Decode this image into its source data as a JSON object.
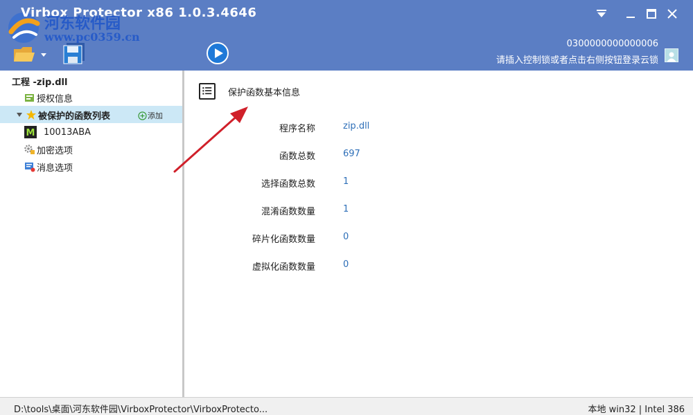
{
  "window": {
    "title": "Virbox Protector x86  1.0.3.4646",
    "controls": [
      "dropdown-icon",
      "minimize-icon",
      "maximize-icon",
      "close-icon"
    ]
  },
  "watermark": {
    "line1": "河东软件园",
    "line2": "www.pc0359.cn"
  },
  "toolbar": {
    "open_icon": "folder-open-icon",
    "save_icon": "save-icon",
    "run_icon": "play-icon"
  },
  "account": {
    "serial": "0300000000000006",
    "hint": "请插入控制锁或者点击右侧按钮登录云锁",
    "login_icon": "user-icon"
  },
  "tree": {
    "root": "工程 -zip.dll",
    "items": [
      {
        "label": "授权信息",
        "icon": "license-icon"
      },
      {
        "label": "被保护的函数列表",
        "icon": "star-icon",
        "add_label": "添加"
      },
      {
        "label": "10013ABA",
        "icon": "function-m-icon"
      },
      {
        "label": "加密选项",
        "icon": "settings-icon"
      },
      {
        "label": "消息选项",
        "icon": "message-icon"
      }
    ]
  },
  "panel": {
    "title": "保护函数基本信息",
    "rows": [
      {
        "label": "程序名称",
        "value": "zip.dll"
      },
      {
        "label": "函数总数",
        "value": "697"
      },
      {
        "label": "选择函数总数",
        "value": "1"
      },
      {
        "label": "混淆函数数量",
        "value": "1"
      },
      {
        "label": "碎片化函数数量",
        "value": "0"
      },
      {
        "label": "虚拟化函数数量",
        "value": "0"
      }
    ]
  },
  "status": {
    "path": "D:\\tools\\桌面\\河东软件园\\VirboxProtector\\VirboxProtecto...",
    "right": "本地 win32  |  Intel 386"
  },
  "colors": {
    "header": "#5b7ec4",
    "selection": "#cce8f6",
    "value_link": "#2e6fb8",
    "arrow": "#d0202a"
  }
}
